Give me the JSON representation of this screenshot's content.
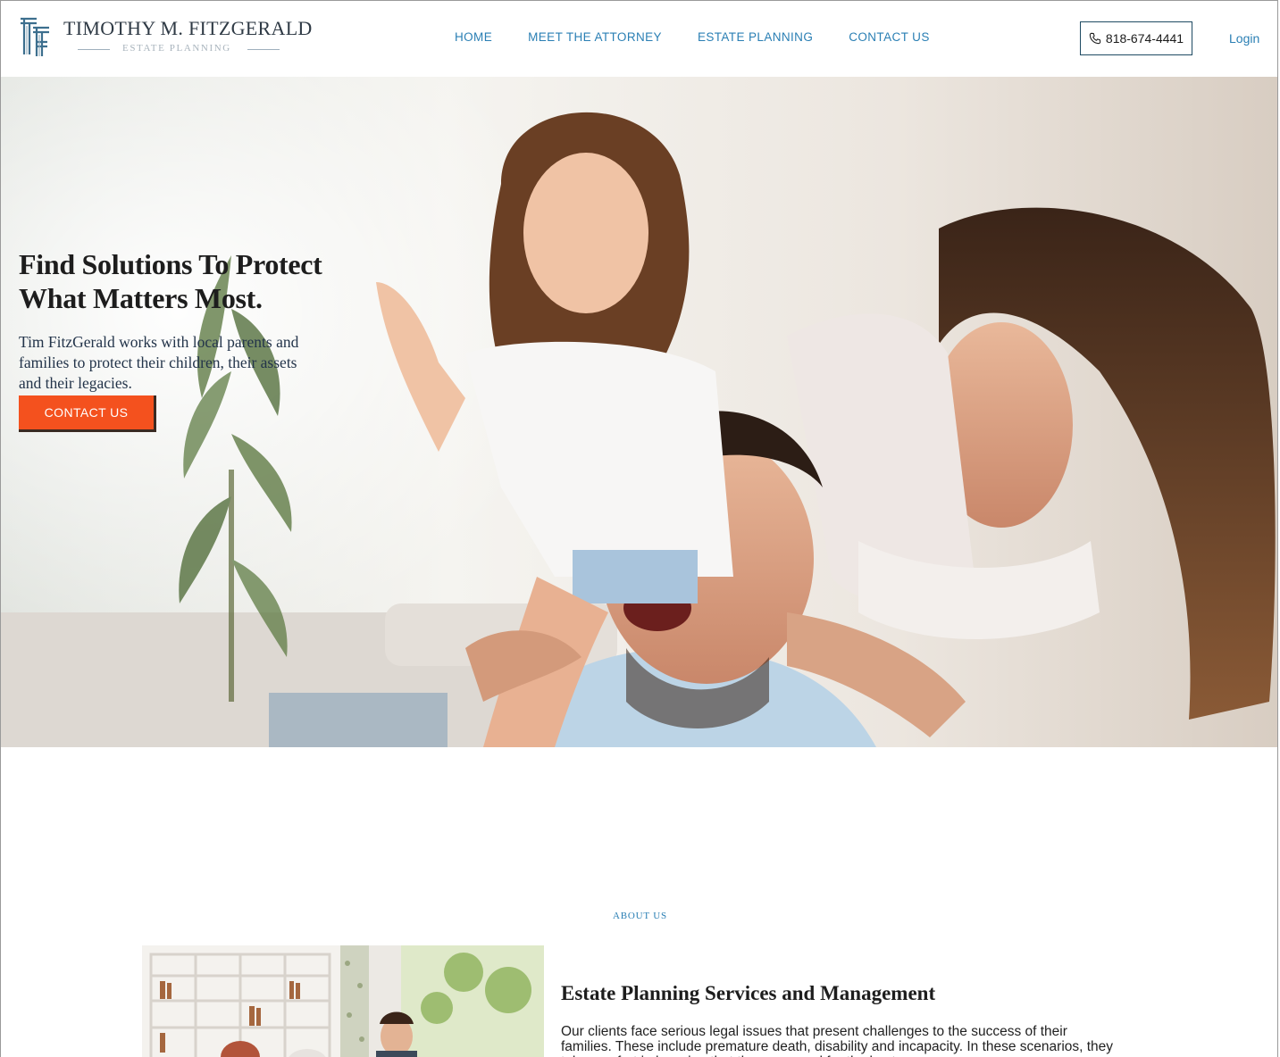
{
  "brand": {
    "name": "TIMOTHY M. FITZGERALD",
    "subtitle": "ESTATE PLANNING",
    "logo_icon": "pillar-monogram-icon"
  },
  "nav": {
    "items": [
      {
        "label": "HOME"
      },
      {
        "label": "MEET THE ATTORNEY"
      },
      {
        "label": "ESTATE PLANNING"
      },
      {
        "label": "CONTACT US"
      }
    ],
    "phone": "818-674-4441",
    "phone_icon": "phone-icon",
    "login": "Login"
  },
  "hero": {
    "title": "Find Solutions To Protect What Matters Most.",
    "text": "Tim FitzGerald works with local parents and families to protect their children, their assets and their legacies.",
    "cta": "CONTACT US"
  },
  "about": {
    "kicker": "ABOUT US",
    "title": "Estate Planning Services and Management",
    "text": "Our clients face serious legal issues that present challenges to the success of their families. These include premature death, disability and incapacity. In these scenarios, they take comfort in knowing that they prepared for the best care"
  },
  "colors": {
    "nav_link": "#2a7fb4",
    "cta": "#f4511e",
    "logo_text": "#2f3a45"
  }
}
